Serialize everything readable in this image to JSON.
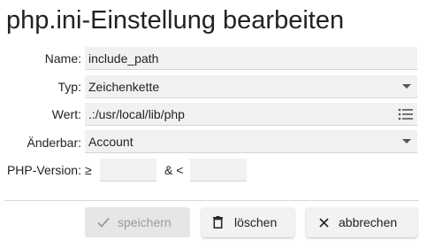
{
  "dialog": {
    "title": "php.ini-Einstellung bearbeiten"
  },
  "form": {
    "name_label": "Name:",
    "name_value": "include_path",
    "type_label": "Typ:",
    "type_value": "Zeichenkette",
    "value_label": "Wert:",
    "value_value": ".:/usr/local/lib/php",
    "changeable_label": "Änderbar:",
    "changeable_value": "Account",
    "version_label": "PHP-Version:",
    "version_min_prefix": "≥",
    "version_sep": "& <",
    "version_min_value": "",
    "version_max_value": ""
  },
  "buttons": {
    "save_label": "speichern",
    "delete_label": "löschen",
    "cancel_label": "abbrechen"
  },
  "icons": {
    "value_list": "list-icon",
    "save": "check-icon",
    "delete": "trash-icon",
    "cancel": "close-icon",
    "dropdown": "caret-down-icon"
  },
  "colors": {
    "field_bg": "#f1f1f1",
    "disabled_text": "#9b9b9b"
  }
}
